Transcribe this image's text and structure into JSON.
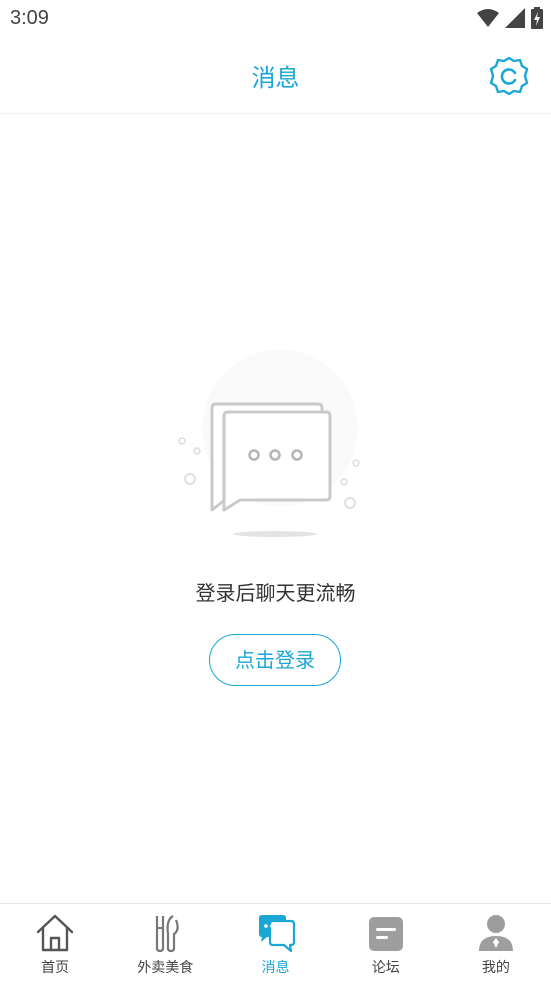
{
  "status_bar": {
    "time": "3:09"
  },
  "header": {
    "title": "消息"
  },
  "empty_state": {
    "message": "登录后聊天更流畅",
    "login_label": "点击登录"
  },
  "bottom_nav": {
    "items": [
      {
        "label": "首页",
        "icon": "home-icon"
      },
      {
        "label": "外卖美食",
        "icon": "utensils-icon"
      },
      {
        "label": "消息",
        "icon": "chat-icon",
        "active": true
      },
      {
        "label": "论坛",
        "icon": "forum-icon"
      },
      {
        "label": "我的",
        "icon": "profile-icon"
      }
    ]
  },
  "colors": {
    "accent": "#1aa7d6",
    "icon_gray": "#9e9e9e"
  }
}
